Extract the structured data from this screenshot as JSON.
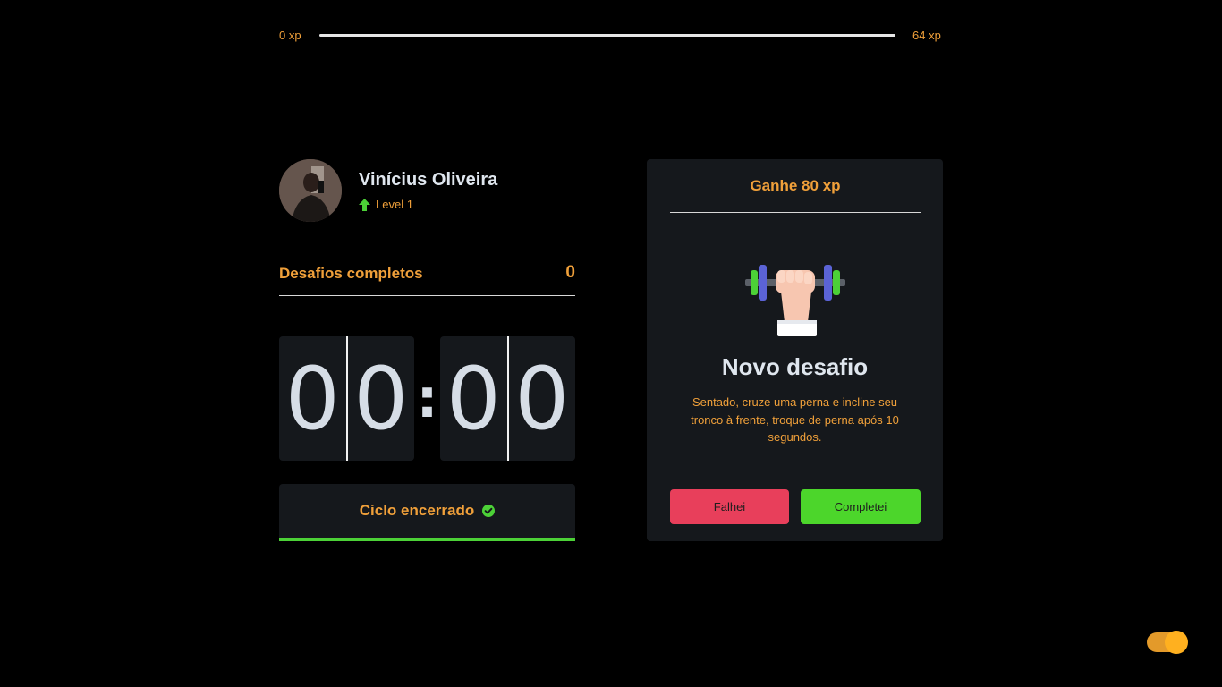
{
  "xp_bar": {
    "min_label": "0 xp",
    "max_label": "64 xp",
    "progress_fraction": 1.0
  },
  "profile": {
    "name": "Vinícius Oliveira",
    "level_label": "Level 1",
    "level_icon": "arrow-up-icon"
  },
  "challenges": {
    "label": "Desafios completos",
    "count": "0"
  },
  "countdown": {
    "minute_left": "0",
    "minute_right": "0",
    "separator": ":",
    "second_left": "0",
    "second_right": "0"
  },
  "cycle": {
    "label": "Ciclo encerrado",
    "icon": "check-circle-icon"
  },
  "challenge_card": {
    "reward": "Ganhe 80 xp",
    "icon": "dumbbell-icon",
    "title": "Novo desafio",
    "description": "Sentado, cruze uma perna e incline seu tronco à frente, troque de perna após 10 segundos.",
    "fail_label": "Falhei",
    "success_label": "Completei"
  },
  "theme_toggle": {
    "icon": "toggle-icon"
  },
  "colors": {
    "background": "#000000",
    "panel": "#15181c",
    "accent_orange": "#f0a03a",
    "text_light": "#dfe6ee",
    "green": "#4cd62b",
    "red": "#e83f5b"
  }
}
